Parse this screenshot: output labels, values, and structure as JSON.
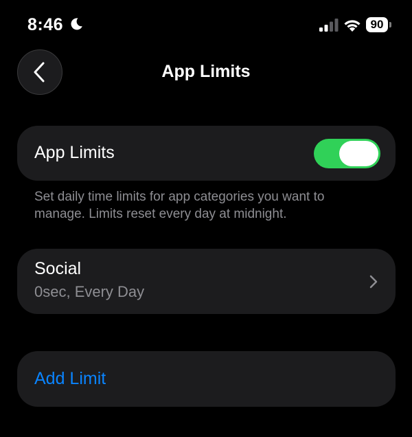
{
  "status_bar": {
    "time": "8:46",
    "battery_level": "90",
    "icons": [
      "moon-icon",
      "signal-icon",
      "wifi-icon",
      "battery-icon"
    ]
  },
  "nav": {
    "back_icon": "chevron-left-icon",
    "title": "App Limits"
  },
  "app_limits_toggle": {
    "label": "App Limits",
    "enabled": true,
    "color_on": "#30d158"
  },
  "description": "Set daily time limits for app categories you want to manage. Limits reset every day at midnight.",
  "limits": [
    {
      "title": "Social",
      "subtitle": "0sec, Every Day",
      "icon": "chevron-right-icon"
    }
  ],
  "add_limit": {
    "label": "Add Limit",
    "color": "#0a84ff"
  }
}
